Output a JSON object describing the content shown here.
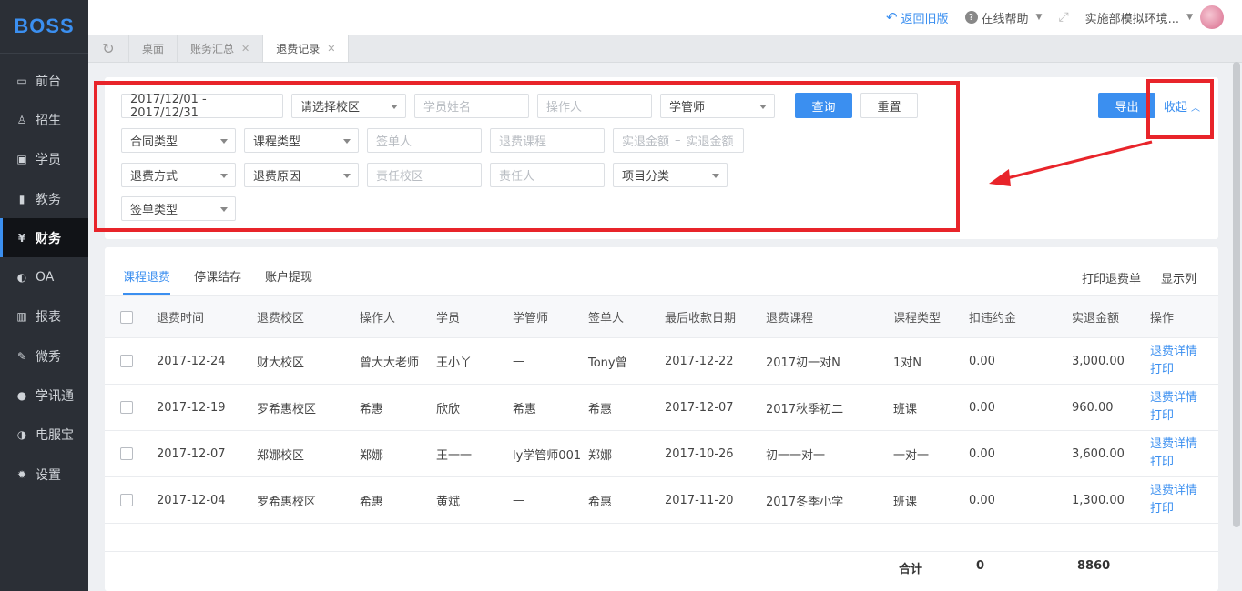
{
  "app": {
    "logo": "BOSS"
  },
  "sidebar": {
    "items": [
      {
        "label": "前台",
        "icon": "calendar-icon"
      },
      {
        "label": "招生",
        "icon": "user-add-icon"
      },
      {
        "label": "学员",
        "icon": "id-card-icon"
      },
      {
        "label": "教务",
        "icon": "book-icon"
      },
      {
        "label": "财务",
        "icon": "yen-icon",
        "active": true
      },
      {
        "label": "OA",
        "icon": "toggle-icon"
      },
      {
        "label": "报表",
        "icon": "bar-chart-icon"
      },
      {
        "label": "微秀",
        "icon": "wei-icon"
      },
      {
        "label": "学讯通",
        "icon": "location-icon"
      },
      {
        "label": "电服宝",
        "icon": "phone-icon"
      },
      {
        "label": "设置",
        "icon": "gear-icon"
      }
    ]
  },
  "topbar": {
    "back": "返回旧版",
    "help": "在线帮助",
    "org": "实施部模拟环境..."
  },
  "tabs": [
    {
      "label": "桌面",
      "closable": false
    },
    {
      "label": "账务汇总",
      "closable": true
    },
    {
      "label": "退费记录",
      "closable": true,
      "active": true
    }
  ],
  "filters": {
    "date_range": "2017/12/01 - 2017/12/31",
    "campus": "请选择校区",
    "student_ph": "学员姓名",
    "operator_ph": "操作人",
    "manager": "学管师",
    "query": "查询",
    "reset": "重置",
    "export": "导出",
    "collapse": "收起",
    "contract_type": "合同类型",
    "course_type": "课程类型",
    "signer_ph": "签单人",
    "refund_course_ph": "退费课程",
    "amount_from_ph": "实退金额",
    "amount_sep": "–",
    "amount_to_ph": "实退金额",
    "refund_method": "退费方式",
    "refund_reason": "退费原因",
    "resp_campus_ph": "责任校区",
    "resp_person_ph": "责任人",
    "item_category": "项目分类",
    "sign_type": "签单类型"
  },
  "subtabs": [
    "课程退费",
    "停课结存",
    "账户提现"
  ],
  "table_actions": {
    "print": "打印退费单",
    "columns": "显示列"
  },
  "table": {
    "headers": [
      "退费时间",
      "退费校区",
      "操作人",
      "学员",
      "学管师",
      "签单人",
      "最后收款日期",
      "退费课程",
      "课程类型",
      "扣违约金",
      "实退金额",
      "操作"
    ],
    "rows": [
      [
        "2017-12-24",
        "财大校区",
        "曾大大老师",
        "王小丫",
        "—",
        "Tony曾",
        "2017-12-22",
        "2017初一对N",
        "1对N",
        "0.00",
        "3,000.00"
      ],
      [
        "2017-12-19",
        "罗希惠校区",
        "希惠",
        "欣欣",
        "希惠",
        "希惠",
        "2017-12-07",
        "2017秋季初二",
        "班课",
        "0.00",
        "960.00"
      ],
      [
        "2017-12-07",
        "郑娜校区",
        "郑娜",
        "王一一",
        "ly学管师001",
        "郑娜",
        "2017-10-26",
        "初一一对一",
        "一对一",
        "0.00",
        "3,600.00"
      ],
      [
        "2017-12-04",
        "罗希惠校区",
        "希惠",
        "黄斌",
        "—",
        "希惠",
        "2017-11-20",
        "2017冬季小学",
        "班课",
        "0.00",
        "1,300.00"
      ]
    ],
    "op_detail": "退费详情",
    "op_print": "打印",
    "total_label": "合计",
    "total_penalty": "0",
    "total_amount": "8860"
  },
  "colors": {
    "accent": "#3b8ff0",
    "highlight": "#e8242a",
    "sidebar": "#2b2f36"
  }
}
